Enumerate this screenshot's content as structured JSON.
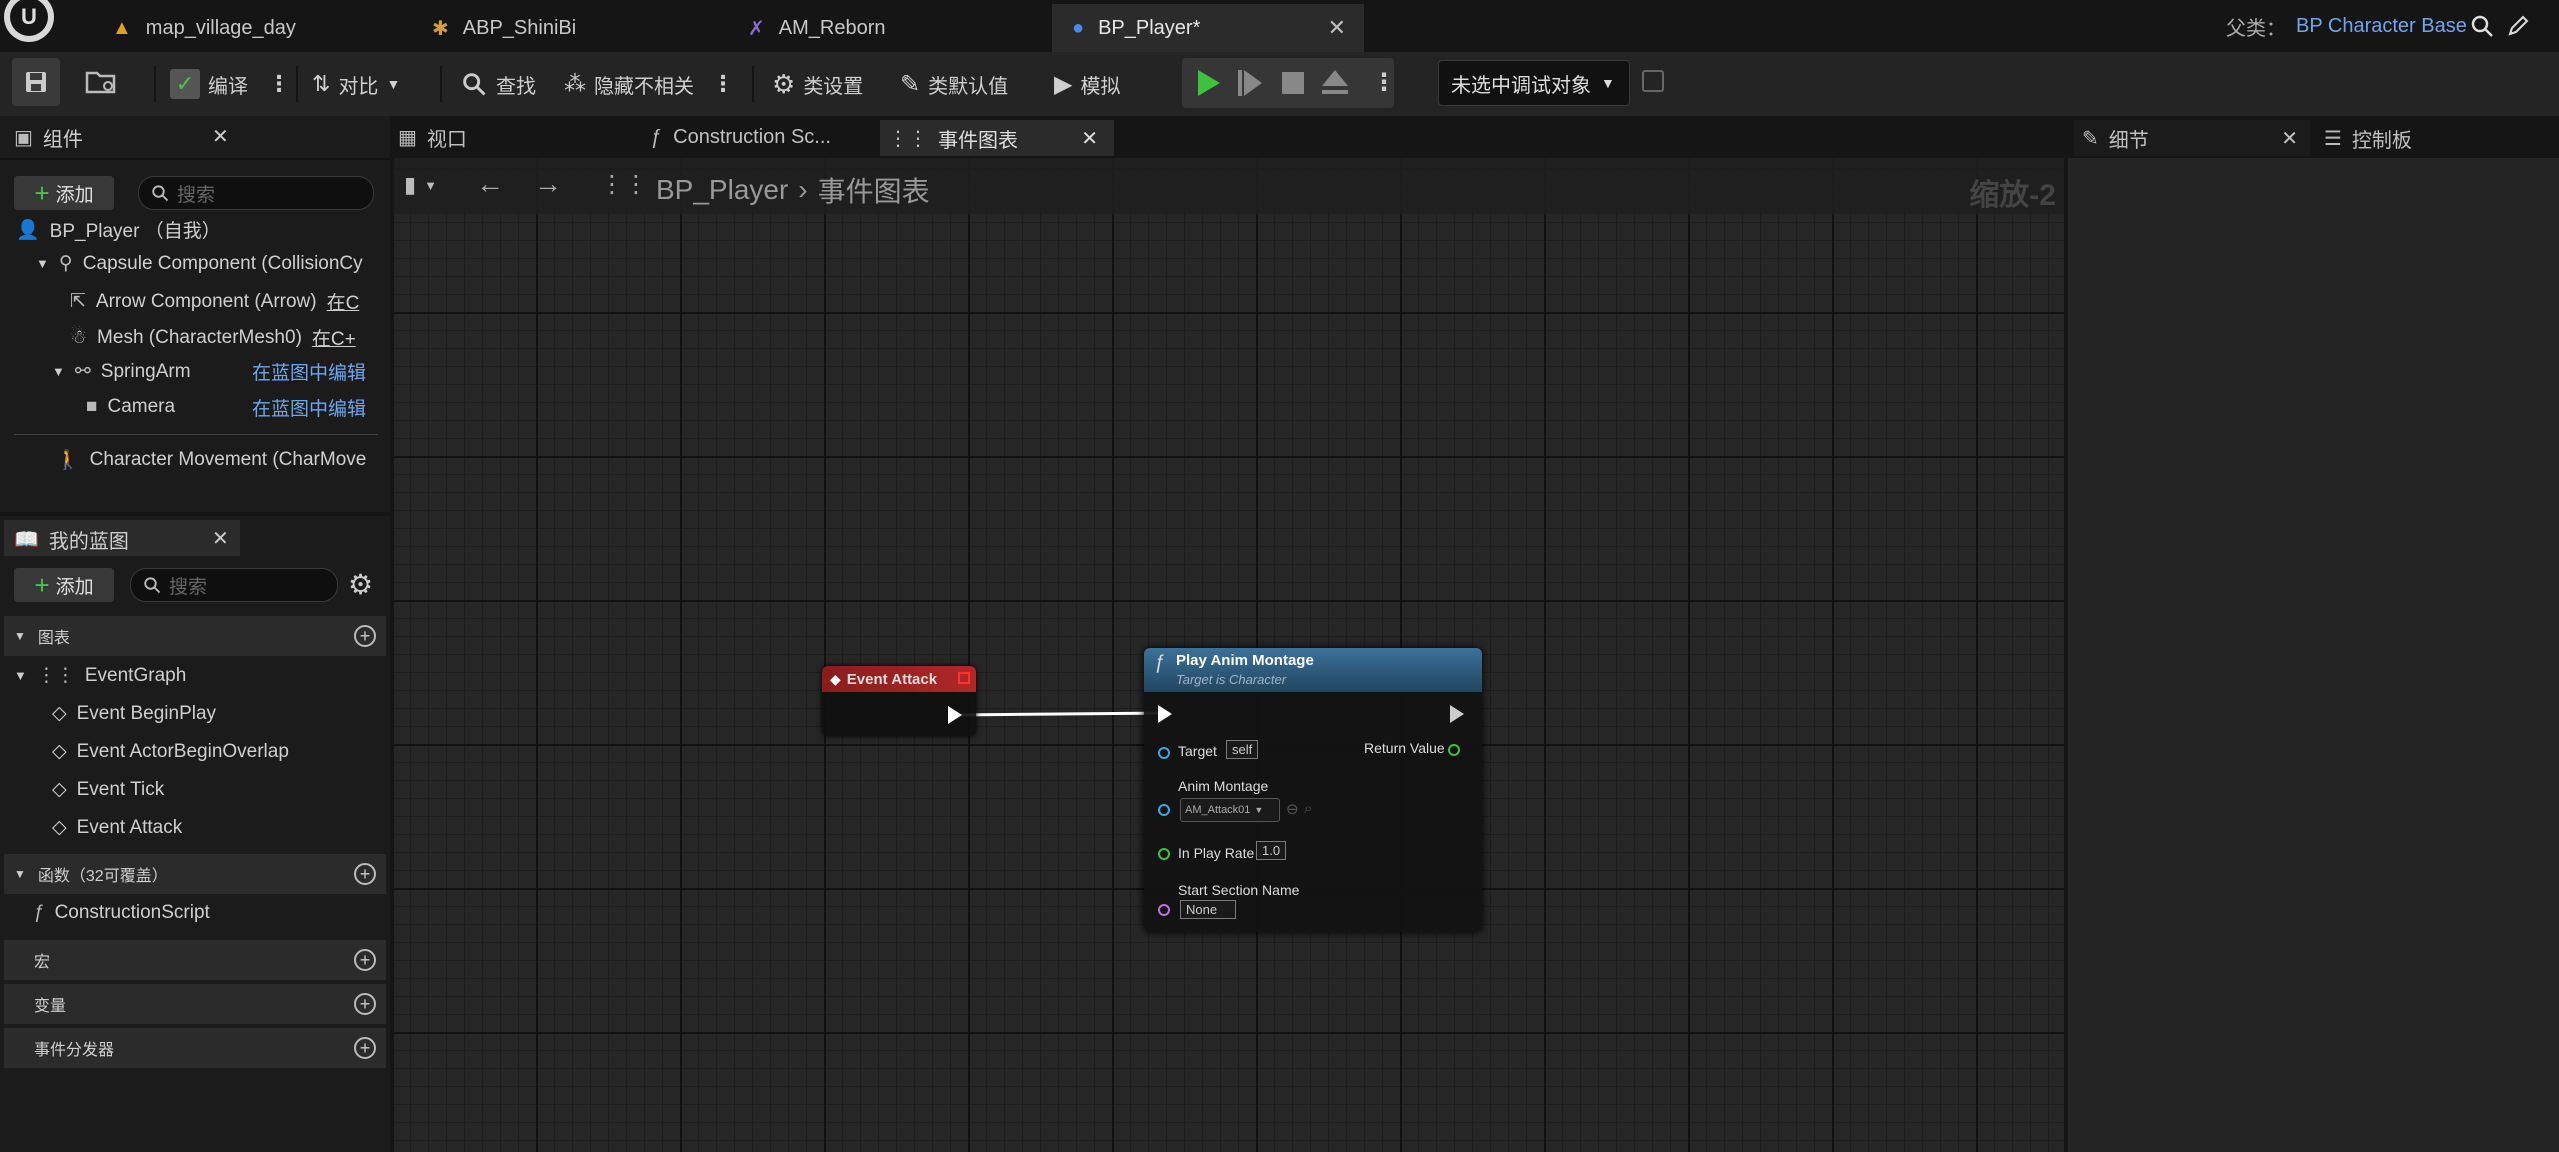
{
  "tabs": [
    {
      "label": "map_village_day",
      "icon": "level-icon"
    },
    {
      "label": "ABP_ShiniBi",
      "icon": "anim-blueprint-icon"
    },
    {
      "label": "AM_Reborn",
      "icon": "anim-montage-icon"
    },
    {
      "label": "BP_Player*",
      "icon": "blueprint-icon"
    }
  ],
  "parent": {
    "label": "父类：",
    "value": "BP Character Base"
  },
  "toolbar": {
    "compile": "编译",
    "diff": "对比",
    "find": "查找",
    "hide_unrelated": "隐藏不相关",
    "class_settings": "类设置",
    "class_defaults": "类默认值",
    "simulate": "模拟",
    "debug_target": "未选中调试对象"
  },
  "components_panel": {
    "title": "组件",
    "add": "添加",
    "search_placeholder": "搜索",
    "items": [
      {
        "name": "BP_Player （自我）"
      },
      {
        "name": "Capsule Component (CollisionCy",
        "link": ""
      },
      {
        "name": "Arrow Component (Arrow)",
        "link": "在C"
      },
      {
        "name": "Mesh (CharacterMesh0)",
        "link": "在C+"
      },
      {
        "name": "SpringArm",
        "link": "在蓝图中编辑"
      },
      {
        "name": "Camera",
        "link": "在蓝图中编辑"
      },
      {
        "name": "Character Movement (CharMove"
      }
    ]
  },
  "my_blueprint": {
    "title": "我的蓝图",
    "add": "添加",
    "search_placeholder": "搜索",
    "graphs_label": "图表",
    "event_graph": "EventGraph",
    "events": [
      "Event BeginPlay",
      "Event ActorBeginOverlap",
      "Event Tick",
      "Event Attack"
    ],
    "functions_label": "函数（32可覆盖）",
    "construction_script": "ConstructionScript",
    "macros_label": "宏",
    "variables_label": "变量",
    "dispatchers_label": "事件分发器"
  },
  "editor_tabs": [
    {
      "label": "视口"
    },
    {
      "label": "Construction Sc..."
    },
    {
      "label": "事件图表"
    }
  ],
  "breadcrumb": {
    "root": "BP_Player",
    "current": "事件图表"
  },
  "zoom": "缩放-2",
  "nodes": {
    "event": {
      "title": "Event Attack"
    },
    "montage": {
      "title": "Play Anim Montage",
      "subtitle": "Target is Character",
      "target": "Target",
      "target_value": "self",
      "return_value": "Return Value",
      "anim_montage": "Anim Montage",
      "anim_montage_value": "AM_Attack01",
      "play_rate": "In Play Rate",
      "play_rate_value": "1.0",
      "start_section": "Start Section Name",
      "start_section_value": "None"
    }
  },
  "right_tabs": [
    {
      "label": "细节"
    },
    {
      "label": "控制板"
    }
  ],
  "colors": {
    "accent_link": "#6ea6f0",
    "event_node": "#8a1c1c",
    "function_node": "#3a6f93",
    "play_green": "#3ec23e"
  }
}
